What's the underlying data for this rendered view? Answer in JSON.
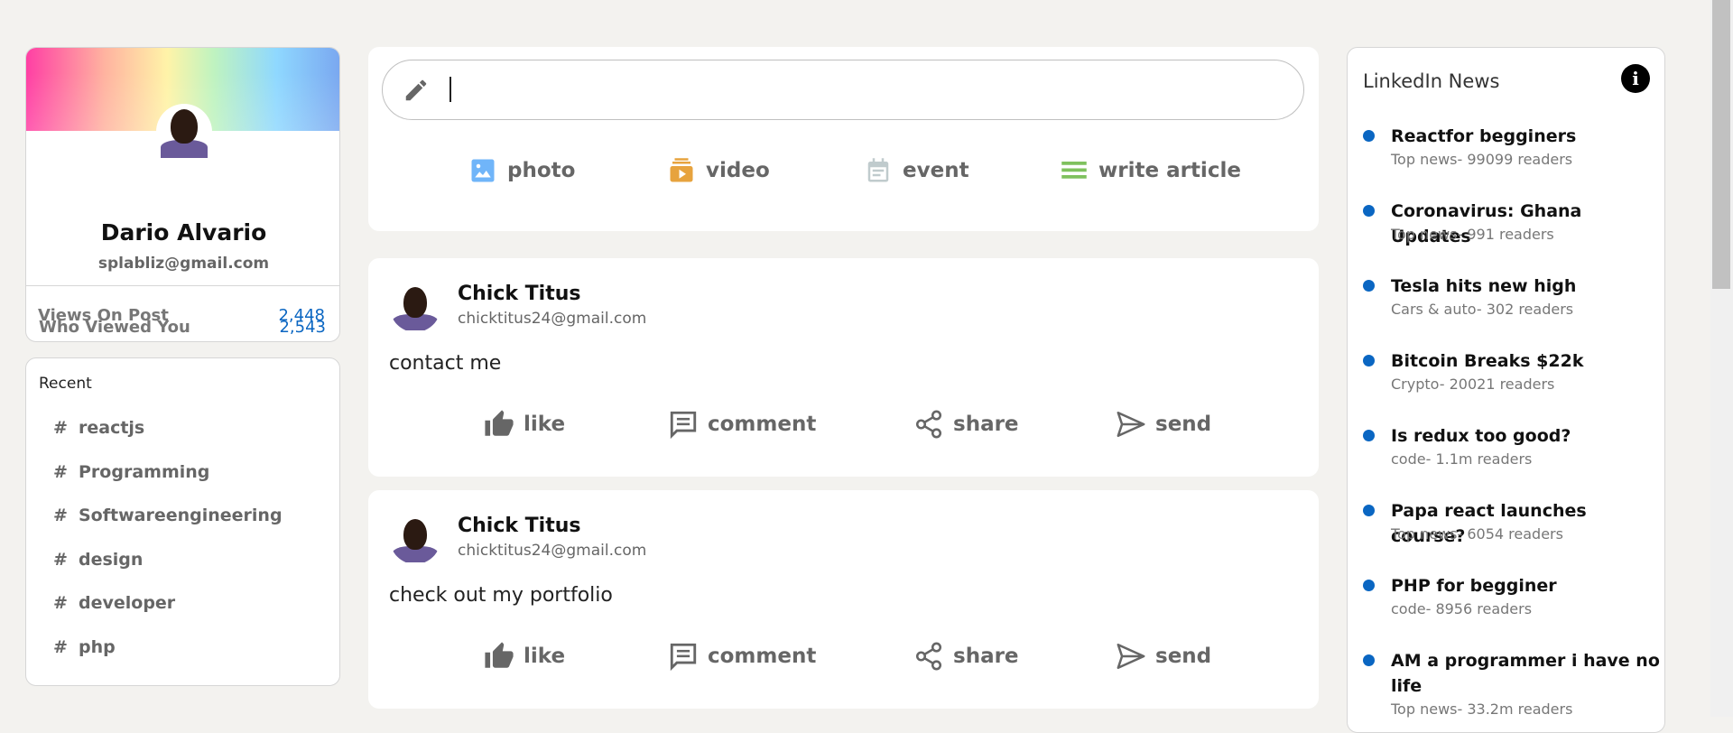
{
  "profile": {
    "name": "Dario Alvario",
    "email": "splabliz@gmail.com",
    "stats": [
      {
        "label": "Who Viewed You",
        "value": "2,543"
      },
      {
        "label": "Views On Post",
        "value": "2,448"
      }
    ]
  },
  "recent": {
    "title": "Recent",
    "items": [
      "reactjs",
      "Programming",
      "Softwareengineering",
      "design",
      "developer",
      "php"
    ],
    "hash": "#"
  },
  "composer": {
    "options": [
      {
        "label": "photo",
        "icon": "photo-icon",
        "color": "#70b5f9"
      },
      {
        "label": "video",
        "icon": "video-icon",
        "color": "#e7a33e"
      },
      {
        "label": "event",
        "icon": "event-icon",
        "color": "#c0cbcd"
      },
      {
        "label": "write article",
        "icon": "article-icon",
        "color": "#7fc15e"
      }
    ]
  },
  "posts": [
    {
      "name": "Chick Titus",
      "email": "chicktitus24@gmail.com",
      "text": "contact me"
    },
    {
      "name": "Chick Titus",
      "email": "chicktitus24@gmail.com",
      "text": "check out my portfolio"
    }
  ],
  "actions": [
    "like",
    "comment",
    "share",
    "send"
  ],
  "news": {
    "title": "LinkedIn News",
    "items": [
      {
        "headline": "Reactfor begginers",
        "sub": "Top news- 99099 readers"
      },
      {
        "headline": "Coronavirus: Ghana Updates",
        "sub": "Top news- 991 readers"
      },
      {
        "headline": "Tesla hits new high",
        "sub": "Cars & auto- 302 readers"
      },
      {
        "headline": "Bitcoin Breaks $22k",
        "sub": "Crypto- 20021 readers"
      },
      {
        "headline": "Is redux too good?",
        "sub": "code- 1.1m readers"
      },
      {
        "headline": "Papa react launches course?",
        "sub": "Top news- 6054 readers"
      },
      {
        "headline": "PHP for begginer",
        "sub": "code- 8956 readers"
      },
      {
        "headline": "AM a programmer i have no life",
        "sub": "Top news- 33.2m readers"
      }
    ]
  },
  "colors": {
    "accent": "#0a66c2",
    "background": "#f3f2ef"
  }
}
